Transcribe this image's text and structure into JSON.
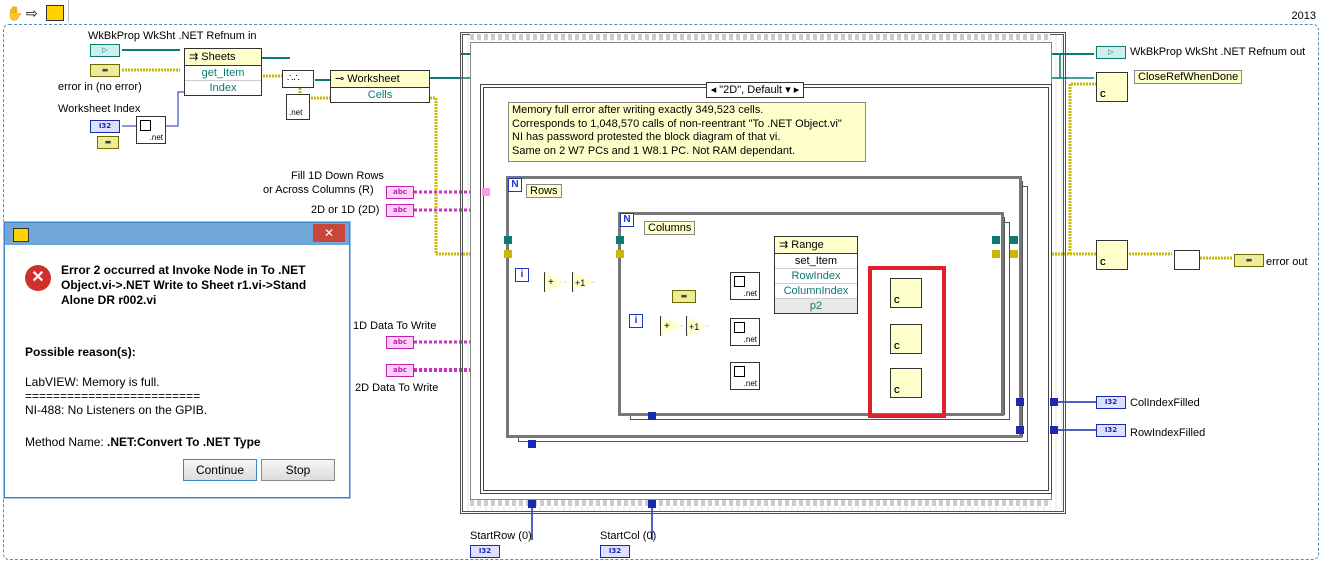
{
  "toolbar": {
    "version": "2013"
  },
  "controls": {
    "wkbk_in": "WkBkProp WkSht .NET Refnum in",
    "error_in": "error in (no error)",
    "worksheet_index": "Worksheet Index",
    "fill_dir_line1": "Fill 1D Down Rows",
    "fill_dir_line2": "or Across Columns (R)",
    "dim_select": "2D or 1D (2D)",
    "data_1d": "1D Data To Write",
    "data_2d": "2D Data To Write",
    "start_row": "StartRow (0)",
    "start_col": "StartCol (0)"
  },
  "indicators": {
    "wkbk_out": "WkBkProp WkSht .NET Refnum out",
    "close_ref": "CloseRefWhenDone",
    "error_out": "error out",
    "col_filled": "ColIndexFilled",
    "row_filled": "RowIndexFilled"
  },
  "nodes": {
    "sheets": {
      "header": "Sheets",
      "method": "get_Item",
      "param": "Index"
    },
    "worksheet": {
      "header": "Worksheet",
      "prop": "Cells"
    },
    "range": {
      "header": "Range",
      "method": "set_Item",
      "p1": "RowIndex",
      "p2": "ColumnIndex",
      "p3": "p2"
    },
    "net_label": ".net",
    "case_selector": "\"2D\", Default",
    "rows_label": "Rows",
    "columns_label": "Columns",
    "loop_n": "N",
    "loop_i": "i",
    "plus": "+",
    "inc": "+1"
  },
  "terminals": {
    "ref": "▷",
    "err": "▬",
    "i32": "I32",
    "str": "abc"
  },
  "comment": [
    "Memory full error after writing exactly 349,523 cells.",
    "Corresponds to 1,048,570 calls of non-reentrant \"To .NET Object.vi\"",
    "NI has password protested the block diagram of that vi.",
    "Same on 2 W7 PCs and 1 W8.1 PC.  Not RAM dependant."
  ],
  "dialog": {
    "message": "Error 2 occurred at Invoke Node in To .NET Object.vi->.NET Write to Sheet r1.vi->Stand Alone DR r002.vi",
    "reasons_heading": "Possible reason(s):",
    "reason1": "LabVIEW:  Memory is full.",
    "separator": "=========================",
    "reason2": "NI-488:  No Listeners on the GPIB.",
    "method_prefix": "Method Name: ",
    "method_name": ".NET:Convert To .NET Type",
    "continue_label": "Continue",
    "stop_label": "Stop",
    "close_label": "✕",
    "error_glyph": "✕"
  },
  "colors": {
    "ref_wire": "#0a7a72",
    "error_wire": "#c9b800",
    "i32_wire": "#1a2ab0",
    "string_wire": "#d030c0",
    "highlight": "#e0202a",
    "comment_bg": "#ffffcc",
    "titlebar": "#6fa7d9"
  }
}
